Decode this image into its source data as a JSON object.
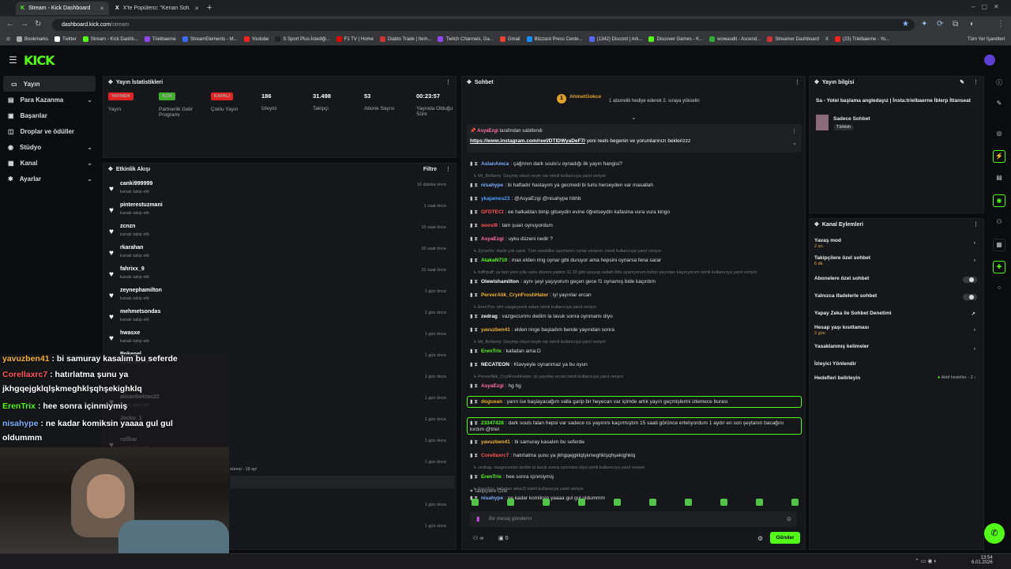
{
  "browser": {
    "tabs": [
      {
        "title": "Stream - Kick Dashboard",
        "active": true
      },
      {
        "title": "X'te Popülerci: \"Kenan Sofuoğlu",
        "active": false
      }
    ],
    "url": {
      "domain": "dashboard.kick.com",
      "path": "/stream"
    },
    "bookmarks": [
      "Bookmarks",
      "Twitter",
      "Stream - Kick Dashb...",
      "Trielbaerne",
      "StreamElements - M...",
      "Youtube",
      "S Sport Plus-İstediği...",
      "F1 TV | Home",
      "Diablo Trade | Item...",
      "Twitch Channels, Ga...",
      "Gmail",
      "Blizzard Press Cente...",
      "(1342) Discord | Ark...",
      "Discover Games - K...",
      "wowaudit - Ascend...",
      "Streamer Dashboard",
      "X",
      "(23) Trielbaerne - Yo..."
    ],
    "all_bookmarks": "Tüm Yer İşaretleri"
  },
  "brand": {
    "logo": "KICK",
    "accent": "#53fc18"
  },
  "sidebar": {
    "items": [
      {
        "label": "Yayın",
        "icon": "camera-icon",
        "active": true
      },
      {
        "label": "Para Kazanma",
        "icon": "money-icon",
        "chevron": true
      },
      {
        "label": "Başarılar",
        "icon": "trophy-icon"
      },
      {
        "label": "Droplar ve ödüller",
        "icon": "gift-icon"
      },
      {
        "label": "Stüdyo",
        "icon": "studio-icon",
        "chevron": true
      },
      {
        "label": "Kanal",
        "icon": "channel-icon",
        "chevron": true
      },
      {
        "label": "Ayarlar",
        "icon": "gear-icon",
        "chevron": true
      }
    ]
  },
  "stats": {
    "title": "Yayın İstatistikleri",
    "items": [
      {
        "badge": "YAYINDA",
        "badge_color": "#e02424",
        "label": "Yayın"
      },
      {
        "badge": "AÇIK",
        "badge_color": "#3fae2a",
        "label": "Partnerlik Gelir Programı"
      },
      {
        "badge": "KAPALI",
        "badge_color": "#e02424",
        "label": "Çoklu Yayın"
      },
      {
        "value": "186",
        "label": "İzleyici"
      },
      {
        "value": "31.498",
        "label": "Takipçi"
      },
      {
        "value": "53",
        "label": "Abone Sayısı"
      },
      {
        "value": "00:23:57",
        "label": "Yayında Olduğu Süre"
      }
    ]
  },
  "activity": {
    "title": "Etkinlik Akışı",
    "filter": "Filtre",
    "events": [
      {
        "user": "canki999999",
        "sub": "kanalı takip etti",
        "time": "16 dakika önce"
      },
      {
        "user": "pinterestuzmani",
        "sub": "kanalı takip etti",
        "time": "1 saat önce"
      },
      {
        "user": "zcnzn",
        "sub": "kanalı takip etti",
        "time": "15 saat önce"
      },
      {
        "user": "rkarahan",
        "sub": "kanalı takip etti",
        "time": "20 saat önce"
      },
      {
        "user": "fahrixx_9",
        "sub": "kanalı takip etti",
        "time": "21 saat önce"
      },
      {
        "user": "zeynephamilton",
        "sub": "kanalı takip etti",
        "time": "1 gün önce"
      },
      {
        "user": "mehmetsondas",
        "sub": "kanalı takip etti",
        "time": "1 gün önce"
      },
      {
        "user": "hwasxe",
        "sub": "kanalı takip etti",
        "time": "1 gün önce"
      },
      {
        "user": "Pokepel",
        "sub": "kanalı takip etti",
        "time": "1 gün önce"
      },
      {
        "user": "",
        "sub": "",
        "time": "1 gün önce"
      },
      {
        "user": "alicanbektas22",
        "sub": "kanalı takip etti",
        "time": "1 gün önce"
      },
      {
        "user": "Jacku_1",
        "sub": "",
        "time": "1 gün önce"
      },
      {
        "user": "rollbar",
        "sub": "kanalı takip etti",
        "time": "1 gün önce"
      },
      {
        "user": "",
        "sub": "",
        "time": "1 gün önce"
      },
      {
        "user": "",
        "sub": "",
        "time": "1 gün önce"
      },
      {
        "user": "",
        "sub": "",
        "time": "1 gün önce"
      },
      {
        "user": "",
        "sub": "",
        "time": "1 gün önce"
      }
    ],
    "partial_sub": "süresi - 18 ay!"
  },
  "chat": {
    "title": "Sohbet",
    "gifter": "AhmetGokce",
    "gift_text": "1 abonelik hediye ederek 2. sıraya yükselin",
    "pinned_by": "AsyaEzgi",
    "pinned_label": "tarafından sabitlendi",
    "pinned_link": "https://www.instagram.com/reel/DTIDWyaDeF7/",
    "pinned_text": "yeni reels begenin ve yorumlarınızı beklerizzz",
    "messages": [
      {
        "user": "AslanAmca",
        "color": "#7ab0ff",
        "text": "çağrının dark souls'u oynadığı ilk yayın hangisi?",
        "reply_above": ""
      },
      {
        "user": "nisahype",
        "color": "#7ab0ff",
        "text": "bi haftadır hastayım ya gecmedi bi turlu herseyden var masallah",
        "reply_above": "Mr_Bellamy: Geçmiş olsun neyin var isimli kullanıcıya yanıt veriyor"
      },
      {
        "user": "ykajames23",
        "color": "#4aa3ff",
        "text": "@AsyaEzgi @nisahype hbhb",
        "reply_above": ""
      },
      {
        "user": "GFDTECI",
        "color": "#ff5555",
        "text": "ee halkaldan binip gitseydin evine öğretseydin kafasina vura vura kingo",
        "reply_above": ""
      },
      {
        "user": "ooosl9",
        "color": "#ff5555",
        "text": "tam şuan oynuyordum",
        "reply_above": ""
      },
      {
        "user": "AsyaEzgi",
        "color": "#ff6fa8",
        "text": "uyku düzeni nedir ?",
        "reply_above": ""
      },
      {
        "user": "AtakaN710",
        "color": "#53fc18",
        "text": "max elden ring oynar gibi duruyor ama hepsini oynarsa fena sarar",
        "reply_above": "ZyraxXx: Harbi çok sardı. Tüm soulslike oyunlarını oynar umarım. isimli kullanıcıya yanıt veriyor"
      },
      {
        "user": "Olewishamilton",
        "color": "#ffffff",
        "text": "aynı şeyi yaşıyorum geçen gece f1 oynamış bide kaçırdım",
        "reply_above": "fullfrpuff: ya ben yeni yılla uyku düzeni yaptım 11.30 gibi uyuyup sabah 8da uyanıyorum bütün yayınları kaçırıyorum isimli kullanıcıya yanıt veriyor"
      },
      {
        "user": "PerverAlik_CrynFroshHater",
        "color": "#f2b233",
        "text": "iyi yayınlar ercan",
        "reply_above": ""
      },
      {
        "user": "zedrag",
        "color": "#ffffff",
        "text": "vazgecsınmı dedim la lavuk sonra oynmamı diyo",
        "reply_above": "ErenTrix: olm vazgeçermi adam isimli kullanıcıya yanıt veriyor"
      },
      {
        "user": "yavuzben41",
        "color": "#f2b233",
        "text": "elden ringe başladım bende yayından sonra",
        "reply_above": ""
      },
      {
        "user": "ErenTrix",
        "color": "#53fc18",
        "text": "kafadan ama:D",
        "reply_above": "Mr_Bellamy: Geçmiş olsun neyin var isimli kullanıcıya yanıt veriyor"
      },
      {
        "user": "NECATEON",
        "color": "#ffffff",
        "text": "Klavyeyle oynanmaz ya bu oyun",
        "reply_above": ""
      },
      {
        "user": "AsyaEzgi",
        "color": "#ff6fa8",
        "text": "hg hg",
        "reply_above": "PerverAlik_CrynFroshHater: iyi yayınlar ercan isimli kullanıcıya yanıt veriyor"
      },
      {
        "user": "doguean",
        "color": "#f2b233",
        "text": "yarın ise başlayacağım valla garip bir heyecan var içimde artık yayın geçmişlerini izlemece burası",
        "reply_above": ""
      },
      {
        "user": "23347428",
        "color": "#53fc18",
        "text": "dark souls falan hepsi var sadece cs yayınını kaçırmıştım 15 saati görünce ertelıyordum 1 aydır en son şeytanın bacağını kırdım @triel",
        "reply_above": ""
      },
      {
        "user": "yavuzben41",
        "color": "#f2b233",
        "text": "bi samuray kasalım bu seferde",
        "reply_above": ""
      },
      {
        "user": "Corellaxrc7",
        "color": "#ff5555",
        "text": "hatırlatma şunu ya jkhgqejgklqlşkmeghklşqhşekighklq",
        "reply_above": ""
      },
      {
        "user": "ErenTrix",
        "color": "#53fc18",
        "text": "hee sonra içinmiymiş",
        "reply_above": "zedrag: vazgecsınmı dedim la lavuk sonra oynmamı diyo isimli kullanıcıya yanıt veriyor"
      },
      {
        "user": "nisahype",
        "color": "#7ab0ff",
        "text": "ne kadar komiksin yaaaa gul gul oldummm",
        "reply_above": "ErenTrix: kafadan ama:D isimli kullanıcıya yanıt veriyor"
      }
    ],
    "followers_only": "Takipçilere Özel",
    "input_placeholder": "Bir mesaj gönderin",
    "points": "0",
    "send": "Gönder"
  },
  "stream_info": {
    "title": "Yayın bilgisi",
    "stream_title": "Sa - Yotei başlama angledayız | İnsta:trielbaerne İblerp İttanseat",
    "category": "Sadece Sohbet",
    "tag": "Türkish"
  },
  "channel_actions": {
    "title": "Kanal Eylemleri",
    "items": [
      {
        "label": "Yavaş mod",
        "sub": "2 sn.",
        "control": "chevron"
      },
      {
        "label": "Takipçilere özel sohbet",
        "sub": "6 dk.",
        "control": "chevron"
      },
      {
        "label": "Abonelere özel sohbet",
        "sub": "",
        "control": "toggle"
      },
      {
        "label": "Yalnızca ifadelerle sohbet",
        "sub": "",
        "control": "toggle"
      },
      {
        "label": "Yapay Zeka ile Sohbet Denetimi",
        "sub": "",
        "control": "external"
      },
      {
        "label": "Hesap yaşı kısıtlaması",
        "sub": "2 gün",
        "control": "chevron"
      },
      {
        "label": "Yasaklanmış kelimeler",
        "sub": "",
        "control": "chevron"
      },
      {
        "label": "İzleyici Yönlendir",
        "sub": "",
        "control": "none"
      },
      {
        "label": "Hedefleri belirleyin",
        "sub": "",
        "control": "goal",
        "goal_text": "Aktif hedefler - 2"
      }
    ]
  },
  "overlay": {
    "lines": [
      {
        "user": "yavuzben41",
        "color": "#f2b233",
        "text": ": bi samuray kasalım bu seferde"
      },
      {
        "user": "Corellaxrc7",
        "color": "#ff5555",
        "text": ": hatırlatma şunu ya"
      },
      {
        "user": "",
        "color": "#ffffff",
        "text": "jkhgqejgklqlşkmeghklşqhşekighklq"
      },
      {
        "user": "ErenTrix",
        "color": "#53fc18",
        "text": ": hee sonra içinmiymiş"
      },
      {
        "user": "nisahype",
        "color": "#7ab0ff",
        "text": ": ne kadar komiksin yaaaa gul gul"
      },
      {
        "user": "",
        "color": "#ffffff",
        "text": "oldummm"
      }
    ]
  },
  "taskbar": {
    "time": "13:54",
    "date": "6.01.2026"
  }
}
